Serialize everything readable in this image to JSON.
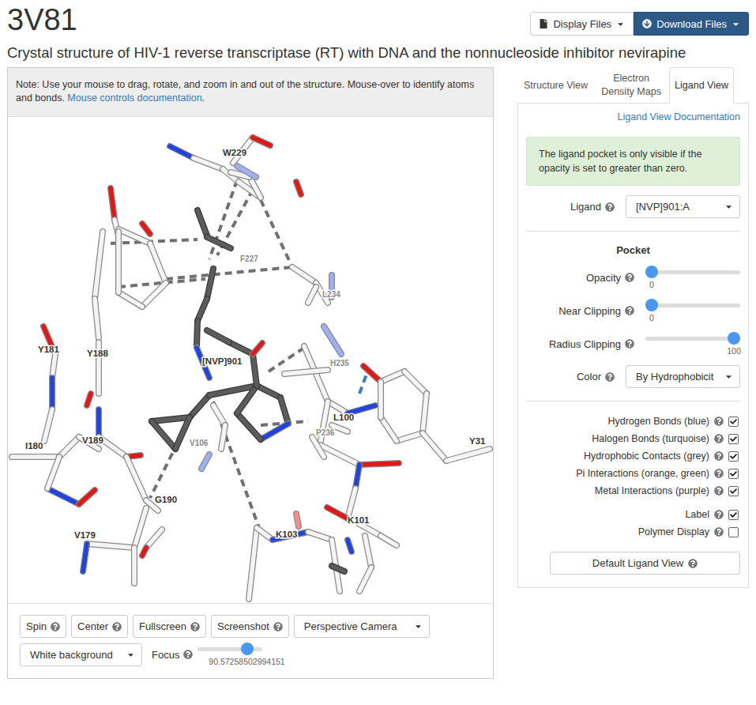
{
  "header": {
    "title": "3V81",
    "subtitle": "Crystal structure of HIV-1 reverse transcriptase (RT) with DNA and the nonnucleoside inhibitor nevirapine",
    "buttons": [
      {
        "label": "Display Files",
        "primary": false
      },
      {
        "label": "Download Files",
        "primary": true
      }
    ]
  },
  "note": {
    "text": "Note: Use your mouse to drag, rotate, and zoom in and out of the structure. Mouse-over to identify atoms and bonds.",
    "link": "Mouse controls documentation",
    "after": "."
  },
  "viewer": {
    "labels": [
      {
        "text": "W229",
        "dim": false
      },
      {
        "text": "F227",
        "dim": true
      },
      {
        "text": "L234",
        "dim": true
      },
      {
        "text": "H235",
        "dim": true
      },
      {
        "text": "Y181",
        "dim": false
      },
      {
        "text": "Y188",
        "dim": false
      },
      {
        "text": "[NVP]901",
        "dim": false
      },
      {
        "text": "L100",
        "dim": false
      },
      {
        "text": "P236",
        "dim": true
      },
      {
        "text": "Y31",
        "dim": false
      },
      {
        "text": "I180",
        "dim": false
      },
      {
        "text": "V189",
        "dim": false
      },
      {
        "text": "V106",
        "dim": true
      },
      {
        "text": "G190",
        "dim": false
      },
      {
        "text": "V179",
        "dim": false
      },
      {
        "text": "K103",
        "dim": false
      },
      {
        "text": "K101",
        "dim": false
      }
    ]
  },
  "controls": {
    "buttons": [
      "Spin",
      "Center",
      "Fullscreen",
      "Screenshot"
    ],
    "camera": "Perspective Camera",
    "background": "White background",
    "focus": {
      "label": "Focus",
      "level": 0.82,
      "value": "90.57258502994151"
    }
  },
  "tabs": [
    {
      "label": "Structure View",
      "selected": false
    },
    {
      "label": "Electron Density Maps",
      "selected": false
    },
    {
      "label": "Ligand View",
      "selected": true
    }
  ],
  "ligand_view": {
    "doc_link": "Ligand View Documentation",
    "alert": "The ligand pocket is only visible if the opacity is set to greater than zero.",
    "ligand": {
      "label": "Ligand",
      "value": "[NVP]901:A"
    },
    "pocket": {
      "title": "Pocket",
      "sliders": [
        {
          "label": "Opacity",
          "level": 0,
          "value": "0"
        },
        {
          "label": "Near Clipping",
          "level": 0,
          "value": "0"
        },
        {
          "label": "Radius Clipping",
          "level": 1,
          "value": "100"
        }
      ],
      "color": {
        "label": "Color",
        "value": "By Hydrophobicit"
      }
    },
    "interactions": [
      {
        "label": "Hydrogen Bonds (blue)",
        "checked": true
      },
      {
        "label": "Halogen Bonds (turquoise)",
        "checked": true
      },
      {
        "label": "Hydrophobic Contacts (grey)",
        "checked": true
      },
      {
        "label": "Pi Interactions (orange, green)",
        "checked": true
      },
      {
        "label": "Metal Interactions (purple)",
        "checked": true
      }
    ],
    "display": [
      {
        "label": "Label",
        "checked": true
      },
      {
        "label": "Polymer Display",
        "checked": false
      }
    ],
    "default_button": "Default Ligand View"
  }
}
